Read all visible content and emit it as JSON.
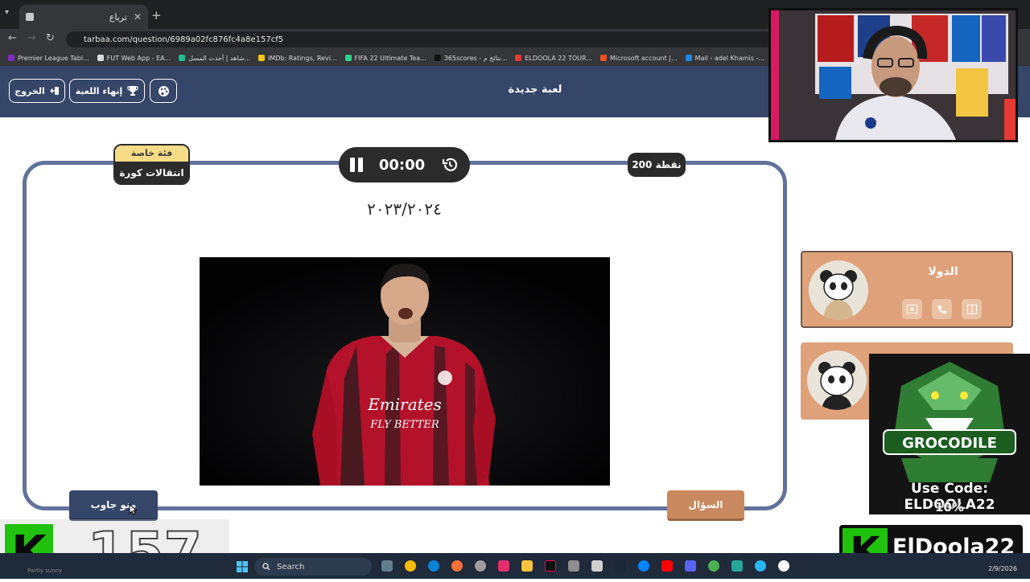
{
  "browser": {
    "tab_title": "ترباع",
    "url": "tarbaa.com/question/6989a02fc876fc4a8e157cf5",
    "bookmarks": [
      {
        "label": "Premier League Tabl...",
        "color": "#7b2cbf"
      },
      {
        "label": "FUT Web App - EA...",
        "color": "#dddddd"
      },
      {
        "label": "شاهد | أحدث المسل...",
        "color": "#1fbf8f"
      },
      {
        "label": "IMDb: Ratings, Revi...",
        "color": "#f5c518"
      },
      {
        "label": "FIFA 22 Ultimate Tea...",
        "color": "#2bd48c"
      },
      {
        "label": "365scores - نتائج م...",
        "color": "#111111"
      },
      {
        "label": "ELDOOLA 22 TOUR...",
        "color": "#e53935"
      },
      {
        "label": "Microsoft account |...",
        "color": "#f25022"
      },
      {
        "label": "Mail - adel Khamis -...",
        "color": "#1e88e5"
      }
    ]
  },
  "header": {
    "title": "لعبة جديدة",
    "end_game": "إنهاء اللعبة",
    "exit": "الخروج"
  },
  "question": {
    "category_label": "فئة خاصة",
    "category_name": "انتقالات كورة",
    "timer": "00:00",
    "points": "200 نقطة",
    "text": "٢٠٢٣/٢٠٢٤",
    "shirt_line1": "Emirates",
    "shirt_line2": "FLY BETTER",
    "who_answered": "منو جاوب",
    "question_button": "السؤال"
  },
  "teams": [
    {
      "name": "الدولا"
    },
    {
      "name": ""
    }
  ],
  "overlay": {
    "promo_line1": "Use Code: ELDOOLA22",
    "promo_line2": "10%",
    "logo_word": "GROCODILE",
    "k_number": "157",
    "brand": "ElDoola22",
    "k_letter": "K"
  },
  "taskbar": {
    "search": "Search",
    "date": "2/9/2026",
    "weather": "Partly sunny"
  },
  "colors": {
    "header_bg": "#354668",
    "board_border": "#62729a",
    "team_card": "#dfa17a",
    "question_button": "#c9895e"
  }
}
